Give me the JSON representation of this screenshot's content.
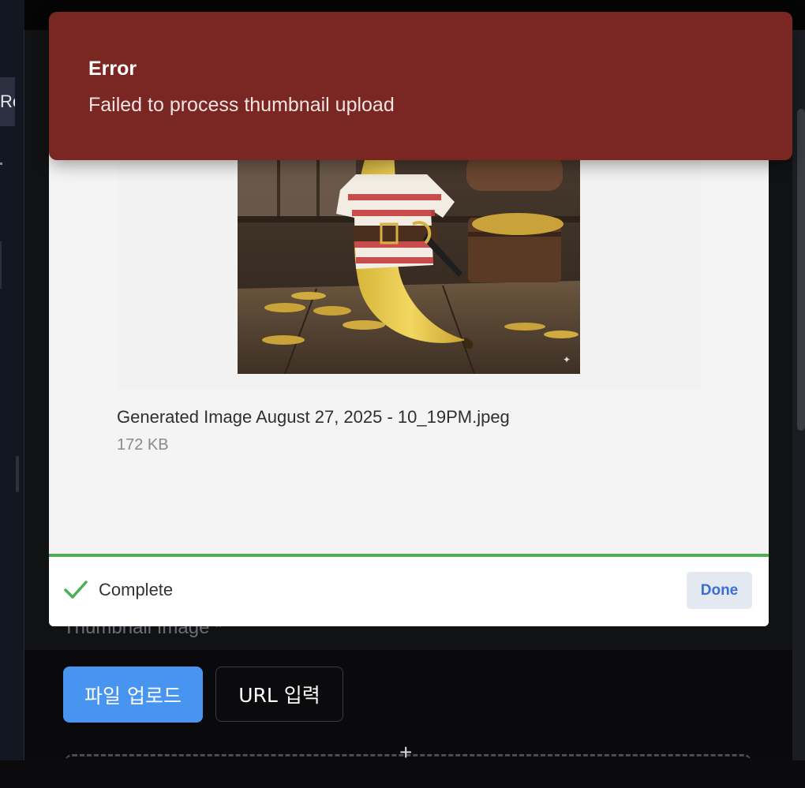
{
  "sidebar": {
    "tab_text": "Re"
  },
  "form": {
    "thumbnail_label": "Thumbnail Image *",
    "upload_file_button": "파일 업로드",
    "url_input_button": "URL 입력",
    "dropzone_icon": "+"
  },
  "upload_modal": {
    "file": {
      "name": "Generated Image August 27, 2025 - 10_19PM.jpeg",
      "size": "172 KB",
      "image_subject": "banana-pirate-illustration"
    },
    "progress": {
      "value": 1.0,
      "color": "#4caf50"
    },
    "status": {
      "label": "Complete",
      "icon": "check-icon",
      "color": "#4caf50"
    },
    "done_button": "Done"
  },
  "toast": {
    "title": "Error",
    "message": "Failed to process thumbnail upload",
    "color": "#7a2623"
  },
  "colors": {
    "accent_blue": "#4795f0",
    "link_blue": "#3b6fcf"
  }
}
